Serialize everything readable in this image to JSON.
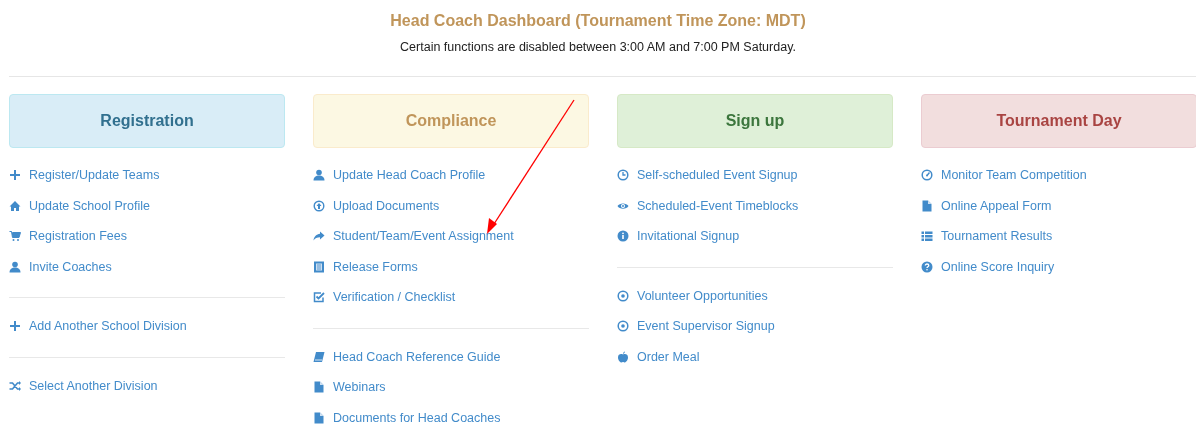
{
  "header": {
    "title": "Head Coach Dashboard (Tournament Time Zone: MDT)",
    "notice": "Certain functions are disabled between 3:00 AM and 7:00 PM Saturday."
  },
  "columns": [
    {
      "title": "Registration",
      "kind": "info",
      "groups": [
        [
          {
            "label": "Register/Update Teams",
            "kind": "plus"
          },
          {
            "label": "Update School Profile",
            "kind": "home"
          },
          {
            "label": "Registration Fees",
            "kind": "cart"
          },
          {
            "label": "Invite Coaches",
            "kind": "user"
          }
        ],
        [
          {
            "label": "Add Another School Division",
            "kind": "plus"
          }
        ],
        [
          {
            "label": "Select Another Division",
            "kind": "shuffle"
          }
        ]
      ]
    },
    {
      "title": "Compliance",
      "kind": "warning",
      "groups": [
        [
          {
            "label": "Update Head Coach Profile",
            "kind": "user"
          },
          {
            "label": "Upload Documents",
            "kind": "upload"
          },
          {
            "label": "Student/Team/Event Assignment",
            "kind": "share"
          },
          {
            "label": "Release Forms",
            "kind": "form"
          },
          {
            "label": "Verification / Checklist",
            "kind": "check"
          }
        ],
        [
          {
            "label": "Head Coach Reference Guide",
            "kind": "book"
          },
          {
            "label": "Webinars",
            "kind": "file"
          },
          {
            "label": "Documents for Head Coaches",
            "kind": "file"
          }
        ]
      ]
    },
    {
      "title": "Sign up",
      "kind": "success",
      "groups": [
        [
          {
            "label": "Self-scheduled Event Signup",
            "kind": "clock"
          },
          {
            "label": "Scheduled-Event Timeblocks",
            "kind": "eye"
          },
          {
            "label": "Invitational Signup",
            "kind": "info"
          }
        ],
        [
          {
            "label": "Volunteer Opportunities",
            "kind": "target"
          },
          {
            "label": "Event Supervisor Signup",
            "kind": "target"
          },
          {
            "label": "Order Meal",
            "kind": "apple"
          }
        ]
      ]
    },
    {
      "title": "Tournament Day",
      "kind": "danger",
      "groups": [
        [
          {
            "label": "Monitor Team Competition",
            "kind": "gauge"
          },
          {
            "label": "Online Appeal Form",
            "kind": "file"
          },
          {
            "label": "Tournament Results",
            "kind": "list"
          },
          {
            "label": "Online Score Inquiry",
            "kind": "question"
          }
        ]
      ]
    }
  ],
  "annotations": [
    {
      "kind": "arrow"
    }
  ]
}
